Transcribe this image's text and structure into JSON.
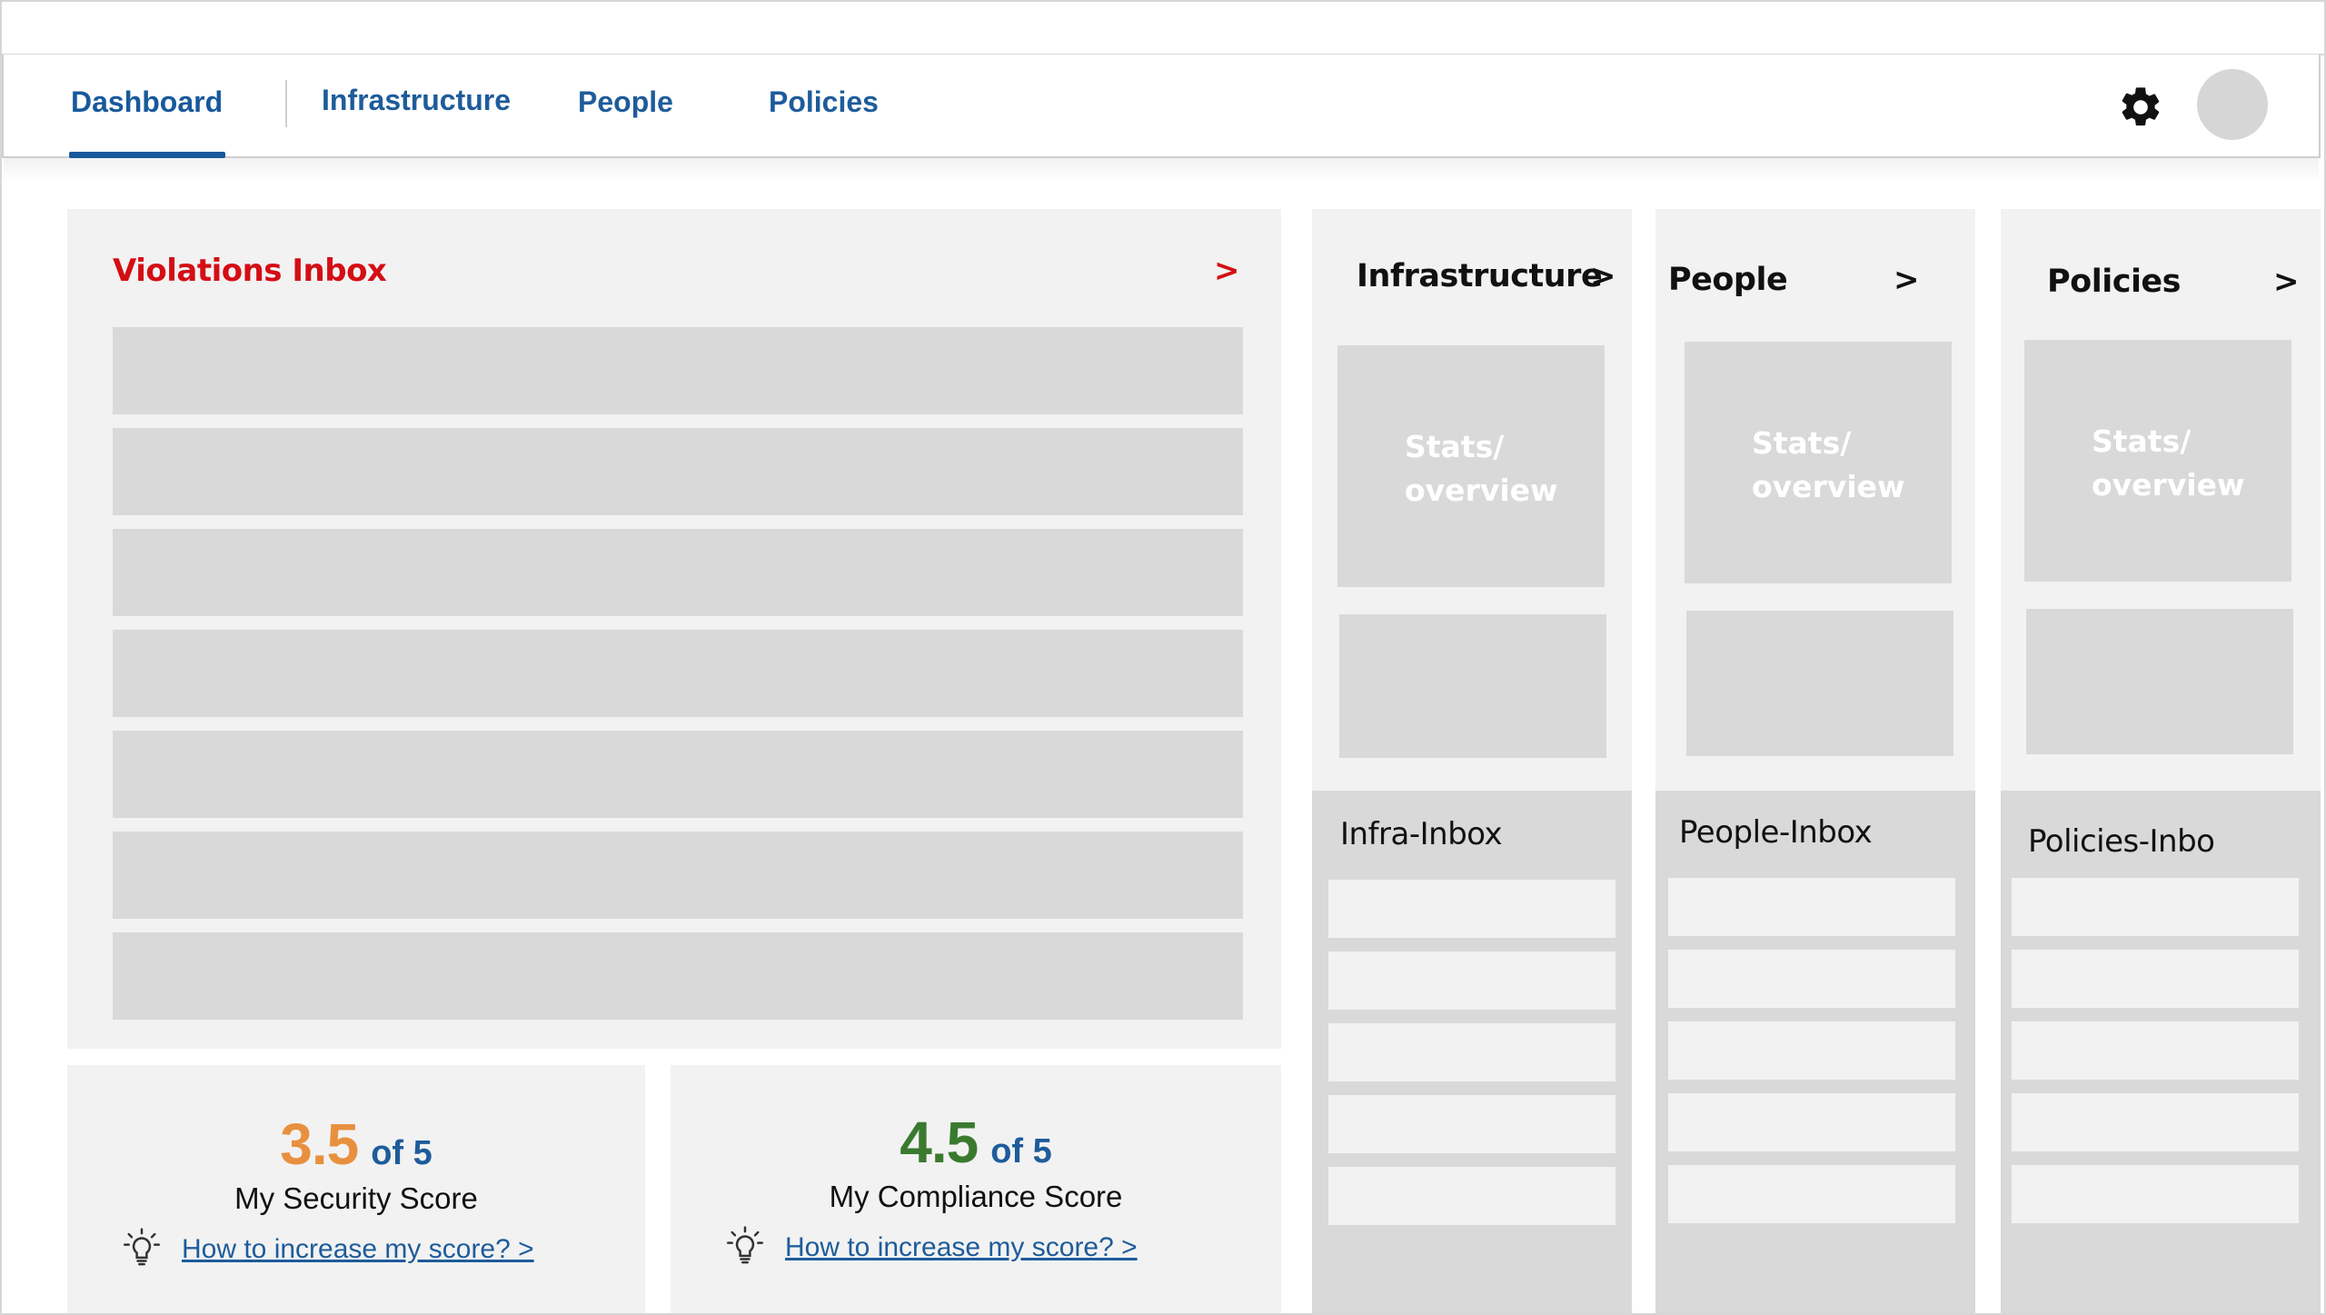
{
  "nav": {
    "tabs": [
      "Dashboard",
      "Infrastructure",
      "People",
      "Policies"
    ],
    "active_tab": "Dashboard"
  },
  "icons": {
    "settings": "gear-icon",
    "user": "avatar",
    "tip": "lightbulb-icon"
  },
  "colors": {
    "nav_text": "#1e5c9a",
    "violations_title": "#d40e14",
    "security_score": "#e8903e",
    "compliance_score": "#3a7a2e"
  },
  "violations": {
    "title": "Violations Inbox",
    "arrow": ">",
    "row_count": 7
  },
  "scores": {
    "security": {
      "value": "3.5",
      "of": "of 5",
      "label": "My Security Score",
      "link": "How to increase my score? >"
    },
    "compliance": {
      "value": "4.5",
      "of": "of 5",
      "label": "My Compliance Score",
      "link": "How to increase my score? >"
    }
  },
  "columns": {
    "infrastructure": {
      "title": "Infrastructure",
      "arrow": ">",
      "stats": [
        "Stats/",
        "overview"
      ],
      "inbox_title": "Infra-Inbox"
    },
    "people": {
      "title": "People",
      "arrow": ">",
      "stats": [
        "Stats/",
        "overview"
      ],
      "inbox_title": "People-Inbox"
    },
    "policies": {
      "title": "Policies",
      "arrow": ">",
      "stats": [
        "Stats/",
        "overview"
      ],
      "inbox_title": "Policies-Inbo"
    }
  }
}
